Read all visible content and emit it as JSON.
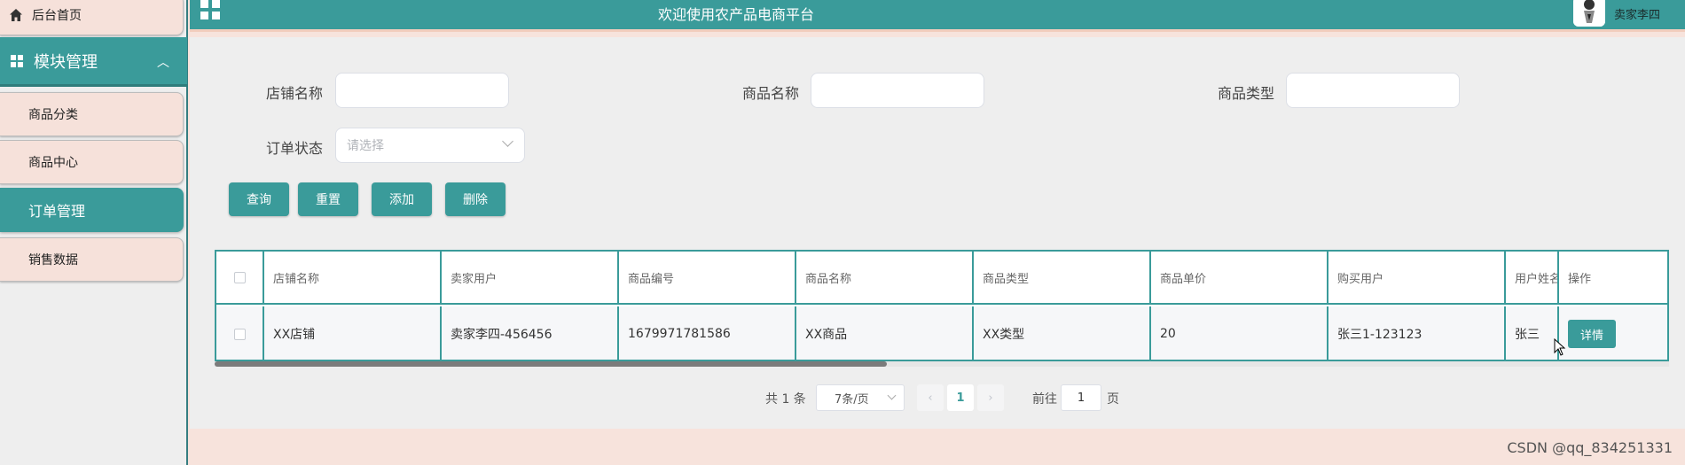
{
  "colors": {
    "accent": "#3a9b9a",
    "page_bg": "#f7e3dc",
    "panel_bg": "#eeeeee"
  },
  "sidebar": {
    "home": {
      "label": "后台首页",
      "icon": "home-icon"
    },
    "section": {
      "label": "模块管理",
      "icon": "grid-icon"
    },
    "items": [
      {
        "label": "商品分类"
      },
      {
        "label": "商品中心"
      },
      {
        "label": "订单管理",
        "active": true
      },
      {
        "label": "销售数据"
      }
    ]
  },
  "header": {
    "title": "欢迎使用农产品电商平台",
    "username": "卖家李四",
    "menu_icon": "grid-icon",
    "avatar_icon": "avatar-icon"
  },
  "filters": {
    "shop_name": {
      "label": "店铺名称",
      "value": ""
    },
    "product_name": {
      "label": "商品名称",
      "value": ""
    },
    "product_type": {
      "label": "商品类型",
      "value": ""
    },
    "order_status": {
      "label": "订单状态",
      "placeholder": "请选择"
    }
  },
  "actions": {
    "query": "查询",
    "reset": "重置",
    "add": "添加",
    "delete": "删除"
  },
  "table": {
    "columns": [
      "店铺名称",
      "卖家用户",
      "商品编号",
      "商品名称",
      "商品类型",
      "商品单价",
      "购买用户",
      "用户姓名",
      "操作"
    ],
    "rows": [
      {
        "cells": [
          "XX店铺",
          "卖家李四-456456",
          "1679971781586",
          "XX商品",
          "XX类型",
          "20",
          "张三1-123123",
          "张三"
        ],
        "action": "详情"
      }
    ]
  },
  "pagination": {
    "total": "共 1 条",
    "page_size": "7条/页",
    "current_page": "1",
    "goto_prefix": "前往",
    "goto_value": "1",
    "goto_suffix": "页"
  },
  "watermark": "CSDN @qq_834251331"
}
